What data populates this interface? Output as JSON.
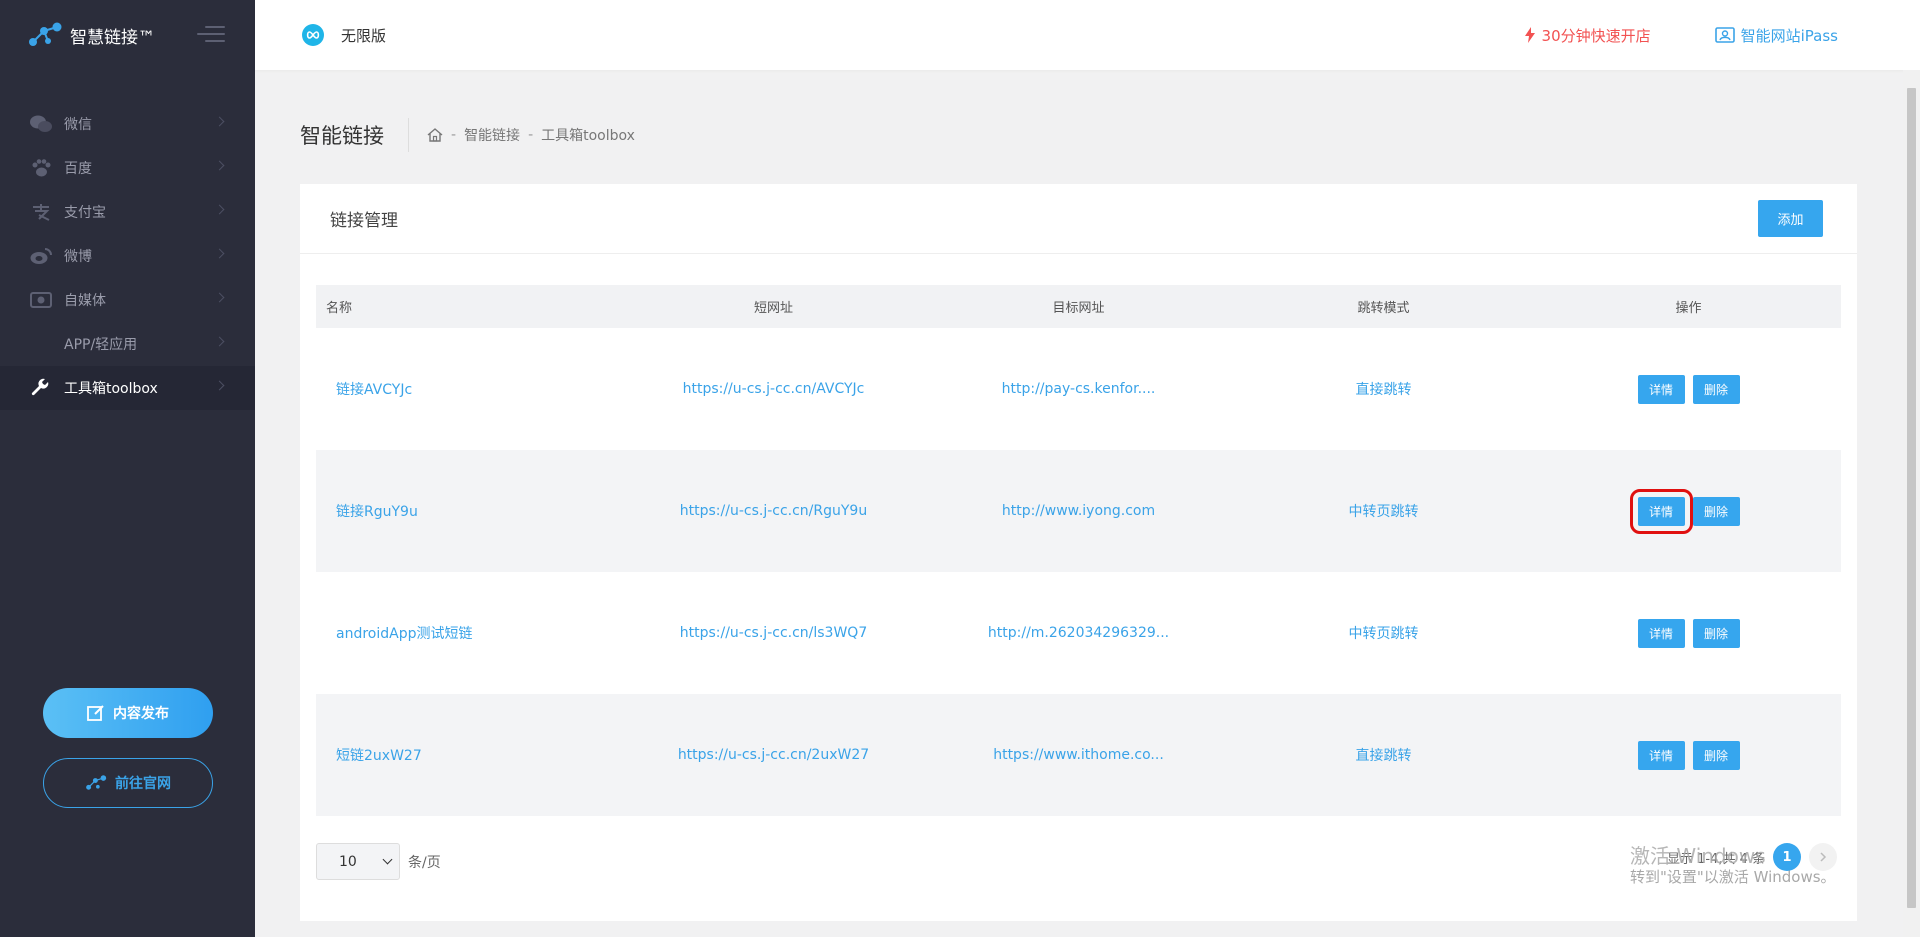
{
  "brand": {
    "name": "智慧链接™"
  },
  "sidebar": {
    "items": [
      {
        "label": "微信",
        "icon": "wechat-icon"
      },
      {
        "label": "百度",
        "icon": "baidu-paw-icon"
      },
      {
        "label": "支付宝",
        "icon": "alipay-icon"
      },
      {
        "label": "微博",
        "icon": "weibo-icon"
      },
      {
        "label": "自媒体",
        "icon": "media-icon"
      },
      {
        "label": "APP/轻应用",
        "icon": "app-icon"
      },
      {
        "label": "工具箱toolbox",
        "icon": "wrench-icon",
        "active": true
      }
    ],
    "publish_label": "内容发布",
    "official_label": "前往官网"
  },
  "topbar": {
    "edition": "无限版",
    "quick_open": "30分钟快速开店",
    "ipass": "智能网站iPass"
  },
  "page": {
    "title": "智能链接",
    "breadcrumb": [
      "智能链接",
      "工具箱toolbox"
    ]
  },
  "card": {
    "title": "链接管理",
    "add_label": "添加"
  },
  "table": {
    "headers": [
      "名称",
      "短网址",
      "目标网址",
      "跳转模式",
      "操作"
    ],
    "rows": [
      {
        "name": "链接AVCYJc",
        "short": "https://u-cs.j-cc.cn/AVCYJc",
        "target": "http://pay-cs.kenfor....",
        "mode": "直接跳转",
        "detail": "详情",
        "delete": "删除"
      },
      {
        "name": "链接RguY9u",
        "short": "https://u-cs.j-cc.cn/RguY9u",
        "target": "http://www.iyong.com",
        "mode": "中转页跳转",
        "detail": "详情",
        "delete": "删除"
      },
      {
        "name": "androidApp测试短链",
        "short": "https://u-cs.j-cc.cn/ls3WQ7",
        "target": "http://m.262034296329...",
        "mode": "中转页跳转",
        "detail": "详情",
        "delete": "删除"
      },
      {
        "name": "短链2uxW27",
        "short": "https://u-cs.j-cc.cn/2uxW27",
        "target": "https://www.ithome.co...",
        "mode": "直接跳转",
        "detail": "详情",
        "delete": "删除"
      }
    ]
  },
  "pager": {
    "page_size": "10",
    "per_page_label": "条/页",
    "info": "显示 1-4,共 4 条",
    "current_page": "1"
  },
  "watermark": {
    "line1": "激活 Windows",
    "line2": "转到\"设置\"以激活 Windows。"
  },
  "colors": {
    "accent": "#36a6ee",
    "sidebar_bg": "#2b2d3b",
    "danger": "#f25252"
  }
}
